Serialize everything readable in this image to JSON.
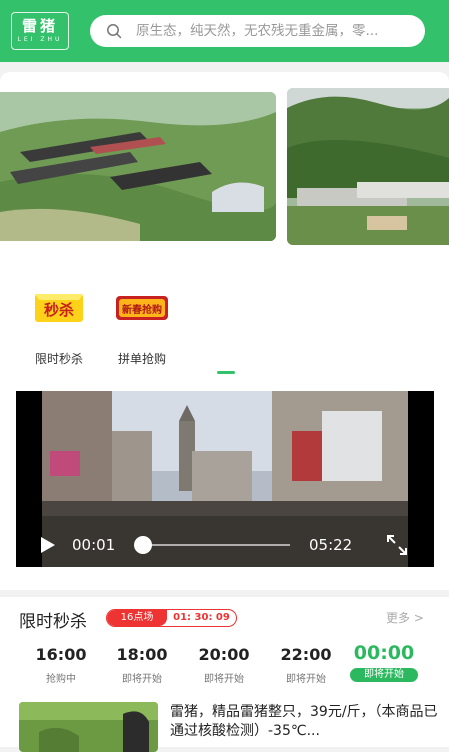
{
  "header": {
    "logo_cn": "雷猪",
    "logo_en": "LEI ZHU",
    "search_placeholder": "原生态，纯天然，无农残无重金属，零..."
  },
  "promo": {
    "items": [
      {
        "label": "限时秒杀",
        "badge_text": "秒杀",
        "icon": "flash-sale-badge-icon"
      },
      {
        "label": "拼单抢购",
        "badge_text": "新春抢购",
        "icon": "group-buy-badge-icon"
      }
    ]
  },
  "video": {
    "current_time": "00:01",
    "total_time": "05:22",
    "progress": 0.0
  },
  "flash_sale": {
    "title": "限时秒杀",
    "session": "16点场",
    "countdown": "01: 30: 09",
    "more": "更多 >",
    "slots": [
      {
        "time": "16:00",
        "status": "抢购中"
      },
      {
        "time": "18:00",
        "status": "即将开始"
      },
      {
        "time": "20:00",
        "status": "即将开始"
      },
      {
        "time": "22:00",
        "status": "即将开始"
      },
      {
        "time": "00:00",
        "status": "即将开始"
      }
    ]
  },
  "product": {
    "description": "雷猪，精品雷猪整只，39元/斤，（本商品已通过核酸检测）-35℃..."
  },
  "colors": {
    "brand_green": "#33c26b",
    "accent_red": "#ee3333"
  }
}
